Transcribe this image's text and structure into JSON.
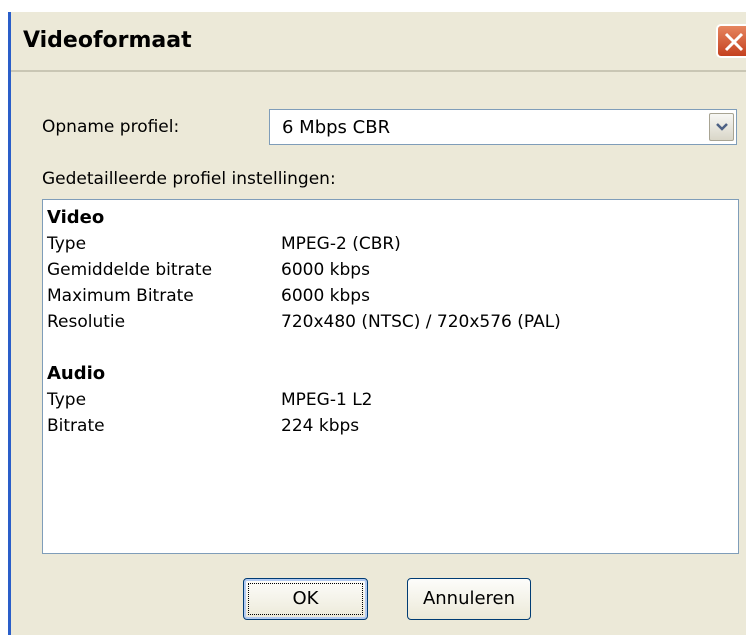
{
  "dialog": {
    "title": "Videoformaat"
  },
  "profile": {
    "label": "Opname profiel:",
    "selected": "6 Mbps CBR"
  },
  "details": {
    "label": "Gedetailleerde profiel instellingen:",
    "video": {
      "heading": "Video",
      "rows": [
        {
          "label": "Type",
          "value": "MPEG-2 (CBR)"
        },
        {
          "label": "Gemiddelde bitrate",
          "value": "6000 kbps"
        },
        {
          "label": "Maximum Bitrate",
          "value": "6000 kbps"
        },
        {
          "label": "Resolutie",
          "value": "720x480 (NTSC) / 720x576 (PAL)"
        }
      ]
    },
    "audio": {
      "heading": "Audio",
      "rows": [
        {
          "label": "Type",
          "value": "MPEG-1 L2"
        },
        {
          "label": "Bitrate",
          "value": "224 kbps"
        }
      ]
    }
  },
  "buttons": {
    "ok": "OK",
    "cancel": "Annuleren"
  },
  "icons": {
    "close": "close-icon",
    "dropdown": "chevron-down-icon"
  },
  "colors": {
    "window_bg": "#ece9d8",
    "close_button": "#c4411f",
    "title_accent": "#2a5ec9"
  }
}
